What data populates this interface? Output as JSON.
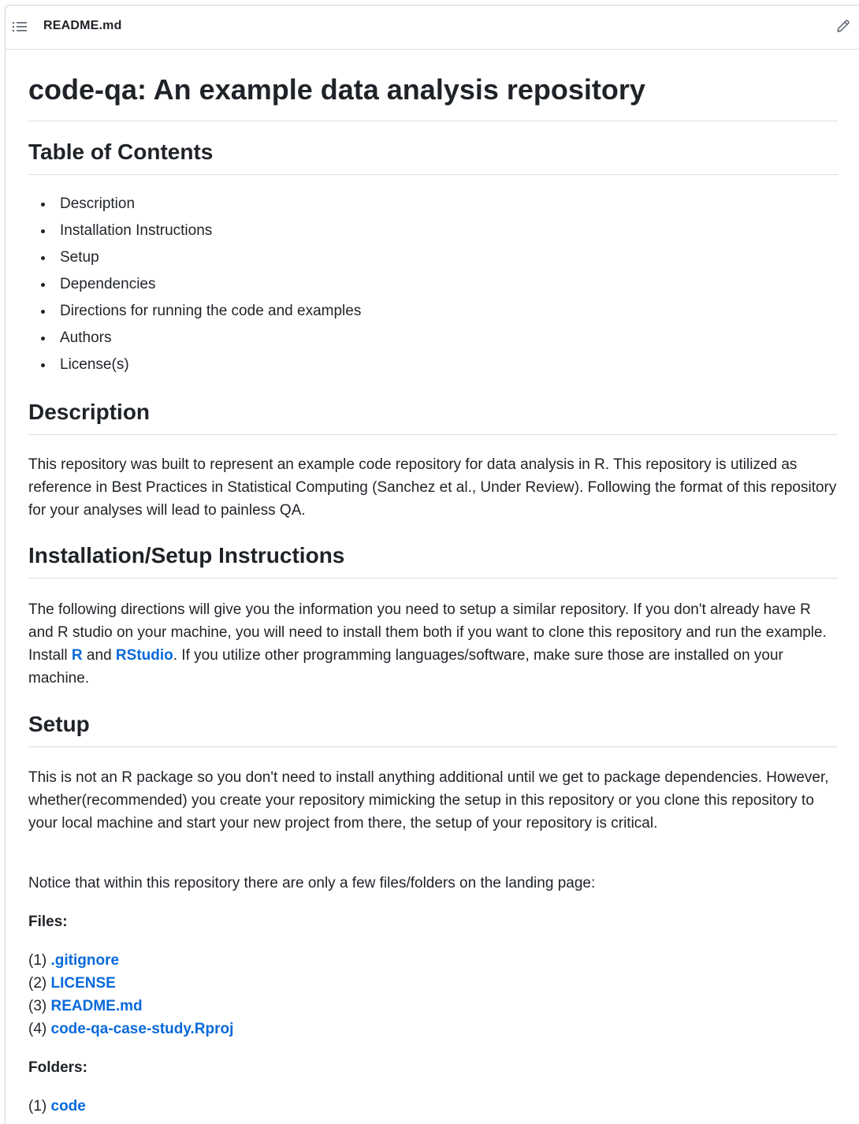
{
  "file_header": {
    "filename": "README.md"
  },
  "title": "code-qa: An example data analysis repository",
  "toc": {
    "heading": "Table of Contents",
    "items": [
      "Description",
      "Installation Instructions",
      "Setup",
      "Dependencies",
      "Directions for running the code and examples",
      "Authors",
      "License(s)"
    ]
  },
  "description": {
    "heading": "Description",
    "text": "This repository was built to represent an example code repository for data analysis in R. This repository is utilized as reference in Best Practices in Statistical Computing (Sanchez et al., Under Review). Following the format of this repository for your analyses will lead to painless QA."
  },
  "installation": {
    "heading": "Installation/Setup Instructions",
    "text_before": "The following directions will give you the information you need to setup a similar repository. If you don't already have R and R studio on your machine, you will need to install them both if you want to clone this repository and run the example. Install ",
    "link_r": "R",
    "text_and": " and ",
    "link_rstudio": "RStudio",
    "text_after": ". If you utilize other programming languages/software, make sure those are installed on your machine."
  },
  "setup": {
    "heading": "Setup",
    "para1": "This is not an R package so you don't need to install anything additional until we get to package dependencies. However, whether(recommended) you create your repository mimicking the setup in this repository or you clone this repository to your local machine and start your new project from there, the setup of your repository is critical.",
    "para2": "Notice that within this repository there are only a few files/folders on the landing page:",
    "files_label": "Files:",
    "files": [
      {
        "num": "(1) ",
        "name": ".gitignore"
      },
      {
        "num": "(2) ",
        "name": "LICENSE"
      },
      {
        "num": "(3) ",
        "name": "README.md"
      },
      {
        "num": "(4) ",
        "name": "code-qa-case-study.Rproj"
      }
    ],
    "folders_label": "Folders:",
    "folders": [
      {
        "num": "(1) ",
        "name": "code"
      }
    ]
  }
}
